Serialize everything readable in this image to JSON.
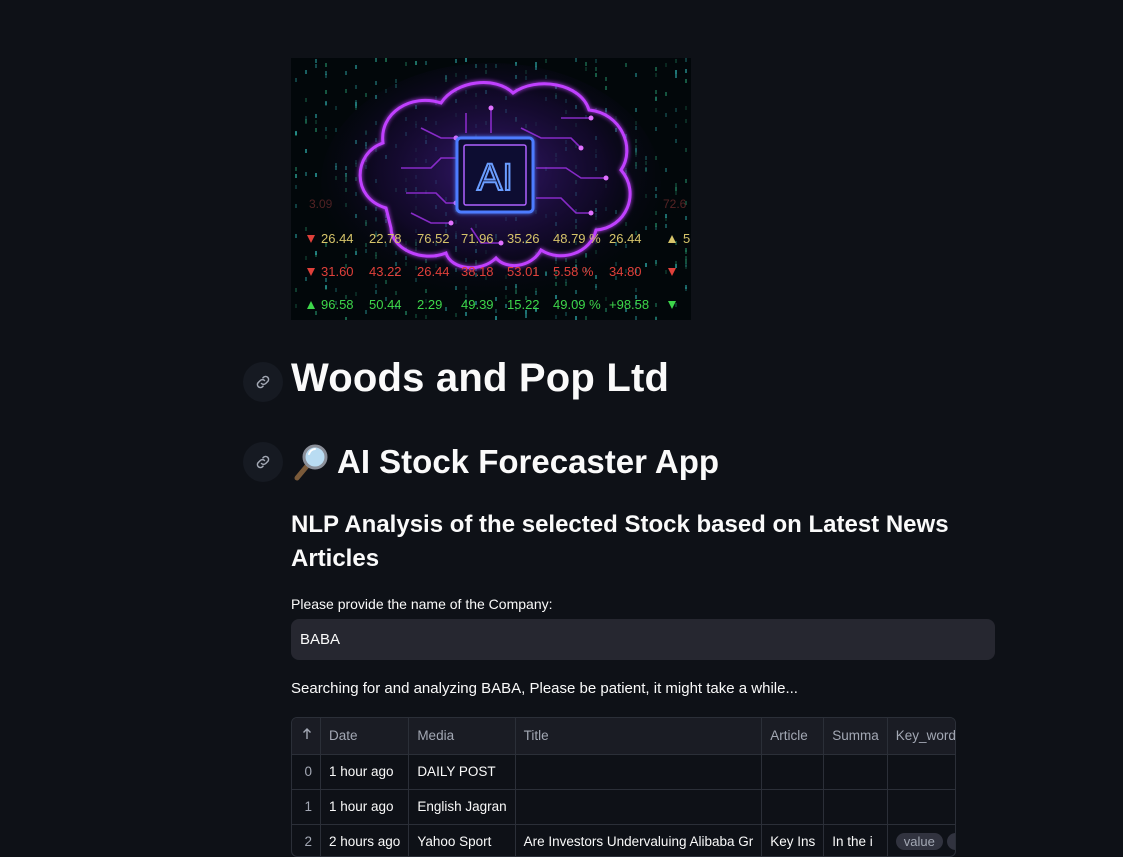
{
  "hero": {
    "center_label": "AI",
    "ticker_rows": [
      {
        "color": "#d6c46a",
        "arrow": "down",
        "values": [
          "26.44",
          "22.78",
          "76.52",
          "71.96",
          "35.26",
          "48.79 %",
          "26.44"
        ],
        "end_arrow": "up",
        "end_value": "5"
      },
      {
        "color": "#e0403a",
        "arrow": "down",
        "values": [
          "31.60",
          "43.22",
          "26.44",
          "38.18",
          "53.01",
          "5.58 %",
          "34.80"
        ],
        "end_arrow": "down",
        "end_value": ""
      },
      {
        "color": "#3dd64a",
        "arrow": "up",
        "values": [
          "96.58",
          "50.44",
          "2.29",
          "49.39",
          "15.22",
          "49.09 %",
          "+98.58"
        ],
        "end_arrow": "down",
        "end_value": ""
      }
    ],
    "faint_values": [
      "3.09",
      "72.6"
    ],
    "colors": {
      "brain": "#c040ff",
      "chip": "#4d7cff",
      "background": "#02070a"
    }
  },
  "title": "Woods and Pop Ltd",
  "app_title": {
    "emoji_icon": "magnifying-glass-icon",
    "text": "AI Stock Forecaster App"
  },
  "subtitle": "NLP Analysis of the selected Stock based on Latest News Articles",
  "company_input": {
    "label": "Please provide the name of the Company:",
    "value": "BABA"
  },
  "status_message": "Searching for and analyzing BABA, Please be patient, it might take a while...",
  "table": {
    "sort_icon": "arrow-up-icon",
    "columns": [
      "Date",
      "Media",
      "Title",
      "Article",
      "Summa",
      "Key_words"
    ],
    "rows": [
      {
        "index": "0",
        "date": "1 hour ago",
        "media": "DAILY POST",
        "title": "",
        "article": "",
        "summary": "",
        "key_words": []
      },
      {
        "index": "1",
        "date": "1 hour ago",
        "media": "English Jagran",
        "title": "",
        "article": "",
        "summary": "",
        "key_words": []
      },
      {
        "index": "2",
        "date": "2 hours ago",
        "media": "Yahoo Sport",
        "title": "Are Investors Undervaluing Alibaba Gr",
        "article": "Key Ins",
        "summary": "In the i",
        "key_words": [
          "value",
          "rat"
        ]
      }
    ]
  },
  "theme": {
    "background": "#0e1117",
    "input_bg": "#262730",
    "text": "#fafafa"
  }
}
